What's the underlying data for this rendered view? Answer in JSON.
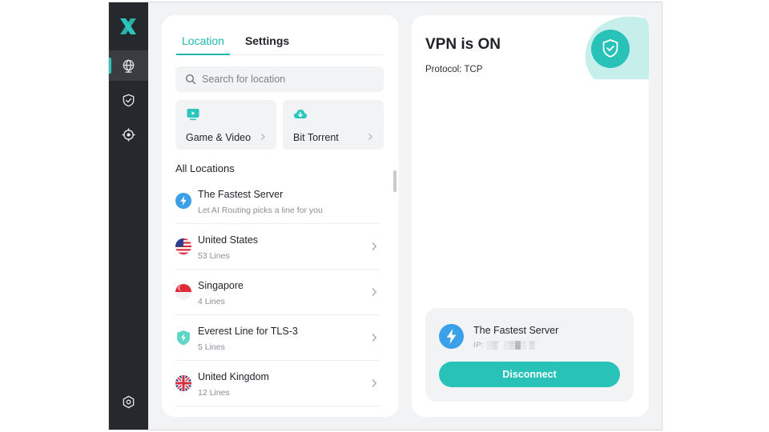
{
  "colors": {
    "accent": "#28c2b9",
    "rail": "#25282c",
    "panel": "#ffffff",
    "background": "#f2f3f5"
  },
  "rail": {
    "items": [
      {
        "name": "globe-icon",
        "active": true
      },
      {
        "name": "shield-check-icon",
        "active": false
      },
      {
        "name": "crosshair-icon",
        "active": false
      }
    ],
    "bottom": {
      "name": "settings-hex-icon"
    }
  },
  "tabs": [
    {
      "label": "Location",
      "active": true
    },
    {
      "label": "Settings",
      "active": false
    }
  ],
  "search": {
    "placeholder": "Search for location",
    "value": ""
  },
  "features": [
    {
      "label": "Game & Video",
      "icon": "tv-play-icon"
    },
    {
      "label": "Bit Torrent",
      "icon": "cloud-download-icon"
    }
  ],
  "locations_title": "All Locations",
  "locations": [
    {
      "name": "The Fastest Server",
      "sub": "Let AI Routing picks a line for you",
      "icon": "lightning-icon"
    },
    {
      "name": "United States",
      "sub": "53 Lines",
      "icon": "flag-us-icon"
    },
    {
      "name": "Singapore",
      "sub": "4 Lines",
      "icon": "flag-sg-icon"
    },
    {
      "name": "Everest Line for TLS-3",
      "sub": "5 Lines",
      "icon": "shield-lightning-icon"
    },
    {
      "name": "United Kingdom",
      "sub": "12 Lines",
      "icon": "flag-uk-icon"
    }
  ],
  "status": {
    "title": "VPN is ON",
    "protocol": "Protocol: TCP",
    "server_name": "The Fastest Server",
    "ip_label": "IP:",
    "disconnect_label": "Disconnect"
  }
}
